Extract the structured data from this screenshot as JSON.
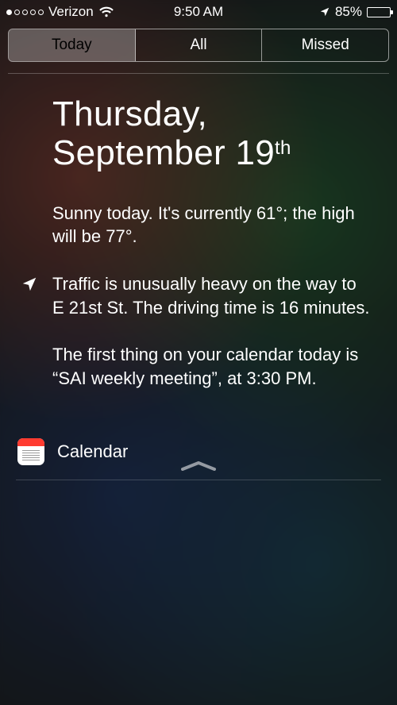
{
  "status": {
    "carrier": "Verizon",
    "time": "9:50 AM",
    "battery_pct": "85%",
    "signal_filled": 1,
    "signal_total": 5
  },
  "tabs": {
    "today": "Today",
    "all": "All",
    "missed": "Missed",
    "active": "today"
  },
  "date": {
    "weekday": "Thursday,",
    "month_day": "September 19",
    "ordinal": "th"
  },
  "weather": "Sunny today. It's currently 61°; the high will be 77°.",
  "traffic": "Traffic is unusually heavy on the way to E 21st St. The driving time is 16 minutes.",
  "calendar_summary": "The first thing on your calendar today is “SAI weekly meeting”, at 3:30 PM.",
  "calendar_label": "Calendar"
}
